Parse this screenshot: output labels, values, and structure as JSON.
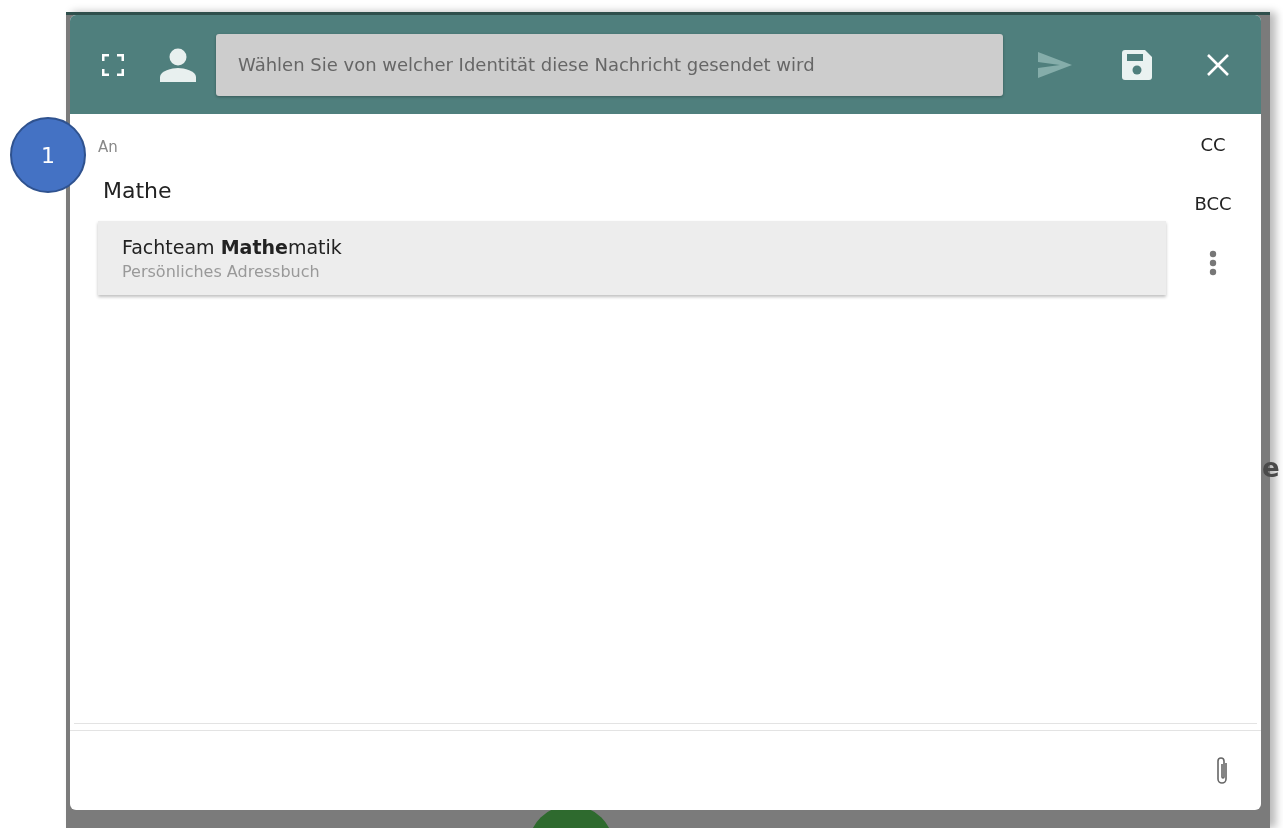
{
  "header": {
    "identity_select": {
      "placeholder": "Wählen Sie von welcher Identität diese Nachricht gesendet wird"
    },
    "send_disabled": true
  },
  "recipients": {
    "label": "An",
    "value": "Mathe",
    "cc": "CC",
    "bcc": "BCC"
  },
  "suggestions": [
    {
      "name": "Fachteam **Mathe**matik",
      "source": "Persönliches Adressbuch"
    }
  ],
  "callout": {
    "label": "1"
  },
  "background": {
    "text_fragment": "e"
  }
}
